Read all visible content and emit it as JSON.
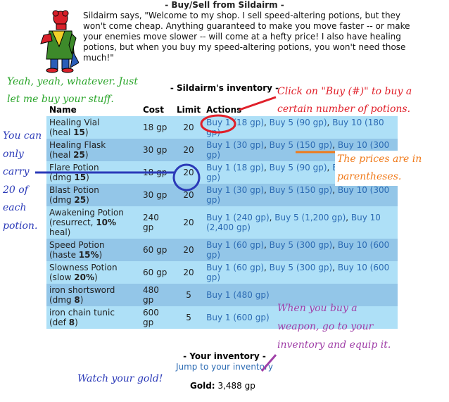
{
  "page": {
    "title": "- Buy/Sell from Sildairm -",
    "shopkeeper_speech": "Sildairm says, \"Welcome to my shop. I sell speed-altering potions, but they won't come cheap. Anything guaranteed to make you move faster -- or make your enemies move slower -- will come at a hefty price! I also have healing potions, but when you buy my speed-altering potions, you won't need those much!\""
  },
  "inventory": {
    "heading": "- Sildairm's inventory -",
    "columns": [
      "Name",
      "Cost",
      "Limit",
      "Actions"
    ],
    "rows": [
      {
        "name": "Healing Vial",
        "stat_prefix": "(heal ",
        "stat_value": "15",
        "stat_suffix": ")",
        "cost": "18 gp",
        "limit": "20",
        "actions": [
          "Buy 1 (18 gp)",
          "Buy 5 (90 gp)",
          "Buy 10 (180 gp)"
        ]
      },
      {
        "name": "Healing Flask",
        "stat_prefix": "(heal ",
        "stat_value": "25",
        "stat_suffix": ")",
        "cost": "30 gp",
        "limit": "20",
        "actions": [
          "Buy 1 (30 gp)",
          "Buy 5 (150 gp)",
          "Buy 10 (300 gp)"
        ]
      },
      {
        "name": "Flare Potion",
        "stat_prefix": "(dmg ",
        "stat_value": "15",
        "stat_suffix": ")",
        "cost": "18 gp",
        "limit": "20",
        "actions": [
          "Buy 1 (18 gp)",
          "Buy 5 (90 gp)",
          "Buy 10 (180 gp)"
        ]
      },
      {
        "name": "Blast Potion",
        "stat_prefix": "(dmg ",
        "stat_value": "25",
        "stat_suffix": ")",
        "cost": "30 gp",
        "limit": "20",
        "actions": [
          "Buy 1 (30 gp)",
          "Buy 5 (150 gp)",
          "Buy 10 (300 gp)"
        ]
      },
      {
        "name": "Awakening Potion",
        "stat_prefix": "(resurrect, ",
        "stat_value": "10%",
        "stat_suffix": " heal)",
        "cost": "240 gp",
        "limit": "20",
        "actions": [
          "Buy 1 (240 gp)",
          "Buy 5 (1,200 gp)",
          "Buy 10 (2,400 gp)"
        ]
      },
      {
        "name": "Speed Potion",
        "stat_prefix": "(haste ",
        "stat_value": "15%",
        "stat_suffix": ")",
        "cost": "60 gp",
        "limit": "20",
        "actions": [
          "Buy 1 (60 gp)",
          "Buy 5 (300 gp)",
          "Buy 10 (600 gp)"
        ]
      },
      {
        "name": "Slowness Potion",
        "stat_prefix": "(slow ",
        "stat_value": "20%",
        "stat_suffix": ")",
        "cost": "60 gp",
        "limit": "20",
        "actions": [
          "Buy 1 (60 gp)",
          "Buy 5 (300 gp)",
          "Buy 10 (600 gp)"
        ]
      },
      {
        "name": "iron shortsword",
        "stat_prefix": "(dmg ",
        "stat_value": "8",
        "stat_suffix": ")",
        "cost": "480 gp",
        "limit": "5",
        "actions": [
          "Buy 1 (480 gp)"
        ]
      },
      {
        "name": "iron chain tunic",
        "stat_prefix": "(def ",
        "stat_value": "8",
        "stat_suffix": ")",
        "cost": "600 gp",
        "limit": "5",
        "actions": [
          "Buy 1 (600 gp)"
        ]
      }
    ]
  },
  "your_inventory": {
    "heading": "- Your inventory -",
    "jump_link": "Jump to your inventory",
    "gold_label": "Gold:",
    "gold_value": "3,488 gp"
  },
  "annotations": {
    "yeah": [
      "Yeah, yeah, whatever. Just",
      "let me buy your stuff."
    ],
    "click": [
      "Click on \"Buy (#)\" to buy a",
      "certain number of potions."
    ],
    "carry": [
      "You can",
      "only",
      "carry",
      "20 of",
      "each",
      "potion."
    ],
    "prices": [
      "The prices are in",
      "parentheses."
    ],
    "weapon": [
      "When you buy a",
      "weapon, go to your",
      "inventory and equip it."
    ],
    "gold": "Watch your gold!",
    "colors": {
      "green": "#2aa52a",
      "red": "#e0202a",
      "blue": "#2b3ab8",
      "orange": "#f07a1a",
      "purple": "#a040a8"
    }
  }
}
